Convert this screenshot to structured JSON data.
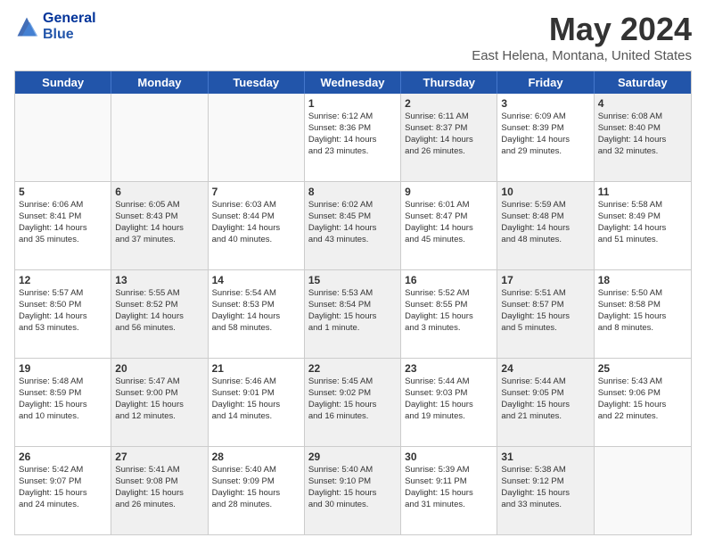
{
  "header": {
    "logo_line1": "General",
    "logo_line2": "Blue",
    "title": "May 2024",
    "subtitle": "East Helena, Montana, United States"
  },
  "days_of_week": [
    "Sunday",
    "Monday",
    "Tuesday",
    "Wednesday",
    "Thursday",
    "Friday",
    "Saturday"
  ],
  "rows": [
    {
      "cells": [
        {
          "day": "",
          "info": "",
          "shaded": false,
          "empty": true
        },
        {
          "day": "",
          "info": "",
          "shaded": false,
          "empty": true
        },
        {
          "day": "",
          "info": "",
          "shaded": false,
          "empty": true
        },
        {
          "day": "1",
          "info": "Sunrise: 6:12 AM\nSunset: 8:36 PM\nDaylight: 14 hours\nand 23 minutes.",
          "shaded": false,
          "empty": false
        },
        {
          "day": "2",
          "info": "Sunrise: 6:11 AM\nSunset: 8:37 PM\nDaylight: 14 hours\nand 26 minutes.",
          "shaded": true,
          "empty": false
        },
        {
          "day": "3",
          "info": "Sunrise: 6:09 AM\nSunset: 8:39 PM\nDaylight: 14 hours\nand 29 minutes.",
          "shaded": false,
          "empty": false
        },
        {
          "day": "4",
          "info": "Sunrise: 6:08 AM\nSunset: 8:40 PM\nDaylight: 14 hours\nand 32 minutes.",
          "shaded": true,
          "empty": false
        }
      ]
    },
    {
      "cells": [
        {
          "day": "5",
          "info": "Sunrise: 6:06 AM\nSunset: 8:41 PM\nDaylight: 14 hours\nand 35 minutes.",
          "shaded": false,
          "empty": false
        },
        {
          "day": "6",
          "info": "Sunrise: 6:05 AM\nSunset: 8:43 PM\nDaylight: 14 hours\nand 37 minutes.",
          "shaded": true,
          "empty": false
        },
        {
          "day": "7",
          "info": "Sunrise: 6:03 AM\nSunset: 8:44 PM\nDaylight: 14 hours\nand 40 minutes.",
          "shaded": false,
          "empty": false
        },
        {
          "day": "8",
          "info": "Sunrise: 6:02 AM\nSunset: 8:45 PM\nDaylight: 14 hours\nand 43 minutes.",
          "shaded": true,
          "empty": false
        },
        {
          "day": "9",
          "info": "Sunrise: 6:01 AM\nSunset: 8:47 PM\nDaylight: 14 hours\nand 45 minutes.",
          "shaded": false,
          "empty": false
        },
        {
          "day": "10",
          "info": "Sunrise: 5:59 AM\nSunset: 8:48 PM\nDaylight: 14 hours\nand 48 minutes.",
          "shaded": true,
          "empty": false
        },
        {
          "day": "11",
          "info": "Sunrise: 5:58 AM\nSunset: 8:49 PM\nDaylight: 14 hours\nand 51 minutes.",
          "shaded": false,
          "empty": false
        }
      ]
    },
    {
      "cells": [
        {
          "day": "12",
          "info": "Sunrise: 5:57 AM\nSunset: 8:50 PM\nDaylight: 14 hours\nand 53 minutes.",
          "shaded": false,
          "empty": false
        },
        {
          "day": "13",
          "info": "Sunrise: 5:55 AM\nSunset: 8:52 PM\nDaylight: 14 hours\nand 56 minutes.",
          "shaded": true,
          "empty": false
        },
        {
          "day": "14",
          "info": "Sunrise: 5:54 AM\nSunset: 8:53 PM\nDaylight: 14 hours\nand 58 minutes.",
          "shaded": false,
          "empty": false
        },
        {
          "day": "15",
          "info": "Sunrise: 5:53 AM\nSunset: 8:54 PM\nDaylight: 15 hours\nand 1 minute.",
          "shaded": true,
          "empty": false
        },
        {
          "day": "16",
          "info": "Sunrise: 5:52 AM\nSunset: 8:55 PM\nDaylight: 15 hours\nand 3 minutes.",
          "shaded": false,
          "empty": false
        },
        {
          "day": "17",
          "info": "Sunrise: 5:51 AM\nSunset: 8:57 PM\nDaylight: 15 hours\nand 5 minutes.",
          "shaded": true,
          "empty": false
        },
        {
          "day": "18",
          "info": "Sunrise: 5:50 AM\nSunset: 8:58 PM\nDaylight: 15 hours\nand 8 minutes.",
          "shaded": false,
          "empty": false
        }
      ]
    },
    {
      "cells": [
        {
          "day": "19",
          "info": "Sunrise: 5:48 AM\nSunset: 8:59 PM\nDaylight: 15 hours\nand 10 minutes.",
          "shaded": false,
          "empty": false
        },
        {
          "day": "20",
          "info": "Sunrise: 5:47 AM\nSunset: 9:00 PM\nDaylight: 15 hours\nand 12 minutes.",
          "shaded": true,
          "empty": false
        },
        {
          "day": "21",
          "info": "Sunrise: 5:46 AM\nSunset: 9:01 PM\nDaylight: 15 hours\nand 14 minutes.",
          "shaded": false,
          "empty": false
        },
        {
          "day": "22",
          "info": "Sunrise: 5:45 AM\nSunset: 9:02 PM\nDaylight: 15 hours\nand 16 minutes.",
          "shaded": true,
          "empty": false
        },
        {
          "day": "23",
          "info": "Sunrise: 5:44 AM\nSunset: 9:03 PM\nDaylight: 15 hours\nand 19 minutes.",
          "shaded": false,
          "empty": false
        },
        {
          "day": "24",
          "info": "Sunrise: 5:44 AM\nSunset: 9:05 PM\nDaylight: 15 hours\nand 21 minutes.",
          "shaded": true,
          "empty": false
        },
        {
          "day": "25",
          "info": "Sunrise: 5:43 AM\nSunset: 9:06 PM\nDaylight: 15 hours\nand 22 minutes.",
          "shaded": false,
          "empty": false
        }
      ]
    },
    {
      "cells": [
        {
          "day": "26",
          "info": "Sunrise: 5:42 AM\nSunset: 9:07 PM\nDaylight: 15 hours\nand 24 minutes.",
          "shaded": false,
          "empty": false
        },
        {
          "day": "27",
          "info": "Sunrise: 5:41 AM\nSunset: 9:08 PM\nDaylight: 15 hours\nand 26 minutes.",
          "shaded": true,
          "empty": false
        },
        {
          "day": "28",
          "info": "Sunrise: 5:40 AM\nSunset: 9:09 PM\nDaylight: 15 hours\nand 28 minutes.",
          "shaded": false,
          "empty": false
        },
        {
          "day": "29",
          "info": "Sunrise: 5:40 AM\nSunset: 9:10 PM\nDaylight: 15 hours\nand 30 minutes.",
          "shaded": true,
          "empty": false
        },
        {
          "day": "30",
          "info": "Sunrise: 5:39 AM\nSunset: 9:11 PM\nDaylight: 15 hours\nand 31 minutes.",
          "shaded": false,
          "empty": false
        },
        {
          "day": "31",
          "info": "Sunrise: 5:38 AM\nSunset: 9:12 PM\nDaylight: 15 hours\nand 33 minutes.",
          "shaded": true,
          "empty": false
        },
        {
          "day": "",
          "info": "",
          "shaded": false,
          "empty": true
        }
      ]
    }
  ]
}
